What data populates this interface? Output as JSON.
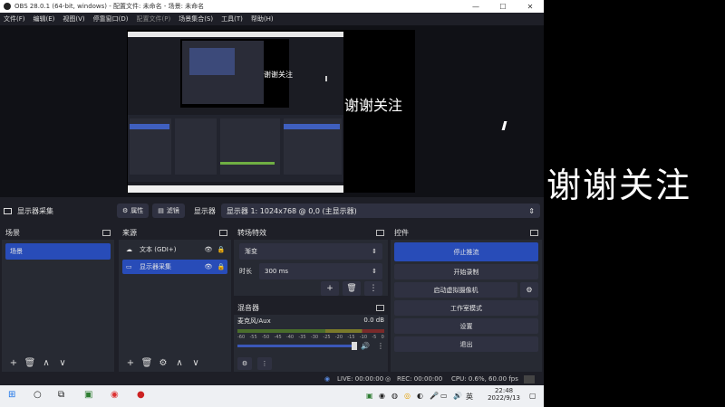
{
  "window": {
    "title": "OBS 28.0.1 (64-bit, windows) - 配置文件: 未命名 - 场景: 未命名",
    "controls": {
      "minimize": "—",
      "maximize": "☐",
      "close": "✕"
    }
  },
  "menu": [
    "文件(F)",
    "编辑(E)",
    "视图(V)",
    "停靠窗口(D)",
    "配置文件(P)",
    "场景集合(S)",
    "工具(T)",
    "帮助(H)"
  ],
  "preview": {
    "overlay_text": "谢谢关注",
    "nested_text": "谢谢关注"
  },
  "external_text": "谢谢关注",
  "source_toolbar": {
    "source_name": "显示器采集",
    "properties_label": "属性",
    "filters_label": "滤镜",
    "display_label": "显示器",
    "display_value": "显示器 1: 1024x768 @ 0,0 (主显示器)"
  },
  "scenes": {
    "header": "场景",
    "items": [
      "场景"
    ],
    "footer_icons": [
      "+",
      "🗑",
      "∧",
      "∨"
    ]
  },
  "sources": {
    "header": "来源",
    "items": [
      {
        "icon": "☁",
        "label": "文本 (GDI+)",
        "selected": false
      },
      {
        "icon": "▭",
        "label": "显示器采集",
        "selected": true
      }
    ],
    "eye_glyph": "👁",
    "lock_glyph": "🔒",
    "footer_icons": [
      "+",
      "🗑",
      "⚙",
      "∧",
      "∨"
    ]
  },
  "transitions": {
    "header": "转场特效",
    "selected": "渐变",
    "duration_label": "时长",
    "duration_value": "300 ms",
    "tools": [
      "+",
      "🗑",
      "⋮"
    ]
  },
  "mixer": {
    "header": "混音器",
    "channel": "麦克风/Aux",
    "level": "0.0 dB",
    "scale": [
      "-60",
      "-55",
      "-50",
      "-45",
      "-40",
      "-35",
      "-30",
      "-25",
      "-20",
      "-15",
      "-10",
      "-5",
      "0"
    ],
    "volume_fraction": 0.95,
    "footer_icons": [
      "⚙",
      "⋮"
    ]
  },
  "controls": {
    "header": "控件",
    "stop_stream": "停止推流",
    "start_record": "开始录制",
    "start_virtualcam": "启动虚拟摄像机",
    "studio_mode": "工作室模式",
    "settings": "设置",
    "exit": "退出"
  },
  "status": {
    "live": "LIVE: 00:00:00",
    "rec": "REC: 00:00:00",
    "cpu": "CPU: 0.6%, 60.00 fps"
  },
  "taskbar": {
    "time": "22:48",
    "date": "2022/9/13",
    "ime": "英"
  },
  "colors": {
    "accent": "#284cb8",
    "panel": "#272a33",
    "background": "#1e1f27"
  }
}
